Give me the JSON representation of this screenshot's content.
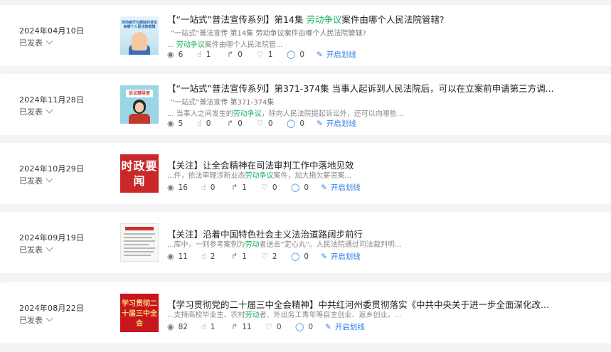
{
  "articles": [
    {
      "date": "2024年04月10日",
      "status": "已发表",
      "thumb_caption": "劳动者行为跟踪的诉讼由哪个人民法院管辖",
      "title_pre": "【“一站式”普法宣传系列】第14集 ",
      "title_hl": "劳动争议",
      "title_post": "案件由哪个人民法院管辖?",
      "subtitle": "“一站式”普法宣传   第14集 劳动争议案件由哪个人民法院管辖?",
      "snippet_pre": "... ",
      "snippet_hl": "劳动争议",
      "snippet_post": "案件由哪个人民法院管...",
      "views": "6",
      "likes": "1",
      "shares": "0",
      "favorites": "1",
      "comments": "0",
      "mark_label": "开启划线"
    },
    {
      "date": "2024年11月28日",
      "status": "已发表",
      "thumb_caption": "诉讼辅导室",
      "title_pre": "【“一站式”普法宣传系列】第371-374集  当事人起诉到人民法院后，可以在立案前申请第三方调...",
      "title_hl": "",
      "title_post": "",
      "subtitle": "“一站式”普法宣传   第371-374集",
      "snippet_pre": "... 当事人之间发生的",
      "snippet_hl": "劳动争议",
      "snippet_post": "，除向人民法院提起诉讼外，还可以向哪些...",
      "views": "5",
      "likes": "0",
      "shares": "0",
      "favorites": "0",
      "comments": "0",
      "mark_label": "开启划线"
    },
    {
      "date": "2024年10月29日",
      "status": "已发表",
      "thumb_caption": "时政要闻",
      "title_pre": "【关注】让全会精神在司法审判工作中落地见效",
      "title_hl": "",
      "title_post": "",
      "subtitle": "",
      "snippet_pre": "...件，依法审理涉新业态",
      "snippet_hl": "劳动争议",
      "snippet_post": "案件，加大拖欠薪资案...",
      "views": "16",
      "likes": "0",
      "shares": "1",
      "favorites": "0",
      "comments": "0",
      "mark_label": "开启划线"
    },
    {
      "date": "2024年09月19日",
      "status": "已发表",
      "thumb_caption": "",
      "title_pre": "【关注】沿着中国特色社会主义法治道路阔步前行",
      "title_hl": "",
      "title_post": "",
      "subtitle": "",
      "snippet_pre": "...库中，一则参考案例为",
      "snippet_hl": "劳动",
      "snippet_post": "者送去“定心丸”。人民法院通过司法裁判明...",
      "views": "11",
      "likes": "2",
      "shares": "1",
      "favorites": "2",
      "comments": "0",
      "mark_label": "开启划线"
    },
    {
      "date": "2024年08月22日",
      "status": "已发表",
      "thumb_caption": "学习贯彻二十届三中全会",
      "title_pre": "【学习贯彻党的二十届三中全会精神】中共红河州委贯彻落实《中共中央关于进一步全面深化改...",
      "title_hl": "",
      "title_post": "",
      "subtitle": "",
      "snippet_pre": "...支持高校毕业生、农村",
      "snippet_hl": "劳动",
      "snippet_post": "者、外出务工青年等自主创业、返乡创业。...",
      "views": "82",
      "likes": "1",
      "shares": "11",
      "favorites": "0",
      "comments": "0",
      "mark_label": "开启划线"
    }
  ],
  "icons": {
    "views": "eye-icon",
    "likes": "thumbs-up-icon",
    "shares": "share-icon",
    "favorites": "heart-icon",
    "comments": "comment-icon",
    "mark": "pen-icon"
  },
  "colors": {
    "highlight": "#19b064",
    "link": "#2d7be5"
  }
}
